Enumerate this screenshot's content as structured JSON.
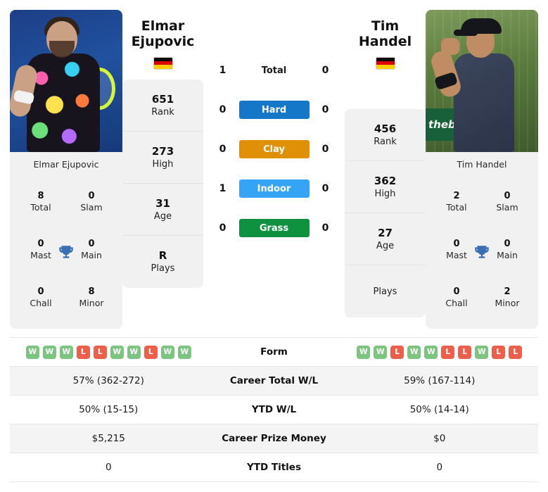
{
  "players": {
    "left": {
      "name": "Elmar Ejupovic",
      "name_line1": "Elmar",
      "name_line2": "Ejupovic",
      "flag": "germany-flag",
      "photo_alt": "elmar-ejupovic-photo",
      "stats": [
        {
          "value": "651",
          "label": "Rank"
        },
        {
          "value": "273",
          "label": "High"
        },
        {
          "value": "31",
          "label": "Age"
        },
        {
          "value": "R",
          "label": "Plays"
        }
      ],
      "titles": [
        {
          "value": "8",
          "label": "Total"
        },
        {
          "value": "0",
          "label": "Slam"
        },
        {
          "value": "0",
          "label": "Mast"
        },
        {
          "value": "0",
          "label": "Main"
        },
        {
          "value": "0",
          "label": "Chall"
        },
        {
          "value": "8",
          "label": "Minor"
        }
      ],
      "form": [
        "W",
        "W",
        "W",
        "L",
        "L",
        "W",
        "W",
        "L",
        "W",
        "W"
      ]
    },
    "right": {
      "name": "Tim Handel",
      "name_line1": "Tim Handel",
      "name_line2": "",
      "flag": "germany-flag",
      "photo_alt": "tim-handel-photo",
      "stats": [
        {
          "value": "456",
          "label": "Rank"
        },
        {
          "value": "362",
          "label": "High"
        },
        {
          "value": "27",
          "label": "Age"
        },
        {
          "value": "",
          "label": "Plays"
        }
      ],
      "titles": [
        {
          "value": "2",
          "label": "Total"
        },
        {
          "value": "0",
          "label": "Slam"
        },
        {
          "value": "0",
          "label": "Mast"
        },
        {
          "value": "0",
          "label": "Main"
        },
        {
          "value": "0",
          "label": "Chall"
        },
        {
          "value": "2",
          "label": "Minor"
        }
      ],
      "form": [
        "W",
        "W",
        "L",
        "W",
        "W",
        "L",
        "L",
        "W",
        "L",
        "L"
      ]
    }
  },
  "head_to_head": [
    {
      "label": "Total",
      "left": "1",
      "right": "0",
      "style": "plain",
      "color": ""
    },
    {
      "label": "Hard",
      "left": "0",
      "right": "0",
      "style": "badge",
      "color": "#1477c8"
    },
    {
      "label": "Clay",
      "left": "0",
      "right": "0",
      "style": "badge",
      "color": "#e09006"
    },
    {
      "label": "Indoor",
      "left": "1",
      "right": "0",
      "style": "badge",
      "color": "#36a4f5"
    },
    {
      "label": "Grass",
      "left": "0",
      "right": "0",
      "style": "badge",
      "color": "#0e9240"
    }
  ],
  "comparison_rows": [
    {
      "label": "Form",
      "left": "",
      "right": "",
      "type": "form"
    },
    {
      "label": "Career Total W/L",
      "left": "57% (362-272)",
      "right": "59% (167-114)",
      "type": "text"
    },
    {
      "label": "YTD W/L",
      "left": "50% (15-15)",
      "right": "50% (14-14)",
      "type": "text"
    },
    {
      "label": "Career Prize Money",
      "left": "$5,215",
      "right": "$0",
      "type": "text"
    },
    {
      "label": "YTD Titles",
      "left": "0",
      "right": "0",
      "type": "text"
    }
  ],
  "icons": {
    "trophy": "trophy-icon",
    "flag": "flag-icon"
  },
  "colors": {
    "win": "#7cc47f",
    "loss": "#ec5f4a",
    "trophy": "#3a6eb5",
    "card_bg": "#f1f1f1"
  }
}
